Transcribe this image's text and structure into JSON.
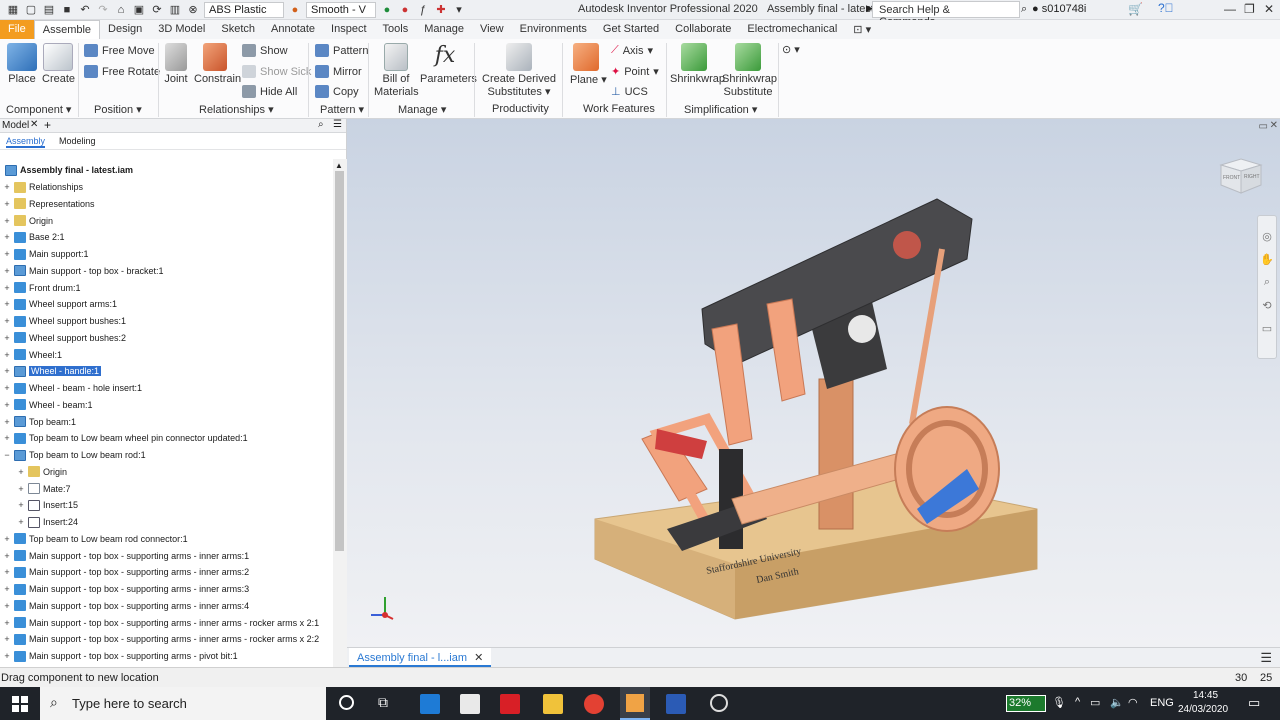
{
  "titlebar": {
    "material": "ABS Plastic",
    "visual_style": "Smooth - V",
    "window_title": "Autodesk Inventor Professional 2020",
    "document_title": "Assembly final - latest",
    "search_placeholder": "Search Help & Commands...",
    "username": "s010748i"
  },
  "menu": {
    "tabs": [
      "File",
      "Assemble",
      "Design",
      "3D Model",
      "Sketch",
      "Annotate",
      "Inspect",
      "Tools",
      "Manage",
      "View",
      "Environments",
      "Get Started",
      "Collaborate",
      "Electromechanical"
    ],
    "active": "Assemble"
  },
  "ribbon": {
    "place": "Place",
    "create": "Create",
    "free_move": "Free Move",
    "free_rotate": "Free Rotate",
    "joint": "Joint",
    "constrain": "Constrain",
    "show": "Show",
    "show_sick": "Show Sick",
    "hide_all": "Hide All",
    "pattern": "Pattern",
    "mirror": "Mirror",
    "copy": "Copy",
    "bill_line1": "Bill of",
    "bill_line2": "Materials",
    "parameters": "Parameters",
    "derived_line1": "Create Derived",
    "derived_line2": "Substitutes",
    "plane": "Plane",
    "axis": "Axis",
    "point": "Point",
    "ucs": "UCS",
    "shrinkwrap": "Shrinkwrap",
    "shrink_sub_line1": "Shrinkwrap",
    "shrink_sub_line2": "Substitute",
    "panels": {
      "component": "Component",
      "position": "Position",
      "relationships": "Relationships",
      "pattern": "Pattern",
      "manage": "Manage",
      "productivity": "Productivity",
      "work_features": "Work Features",
      "simplification": "Simplification"
    }
  },
  "browser": {
    "header": "Model",
    "tabs": [
      "Assembly",
      "Modeling"
    ],
    "root": "Assembly final - latest.iam",
    "nodes": [
      {
        "label": "Relationships",
        "type": "folder",
        "indent": 0
      },
      {
        "label": "Representations",
        "type": "folder",
        "indent": 0
      },
      {
        "label": "Origin",
        "type": "folder",
        "indent": 0
      },
      {
        "label": "Base 2:1",
        "type": "part",
        "indent": 0
      },
      {
        "label": "Main support:1",
        "type": "part",
        "indent": 0
      },
      {
        "label": "Main support - top box - bracket:1",
        "type": "asm",
        "indent": 0
      },
      {
        "label": "Front drum:1",
        "type": "part",
        "indent": 0
      },
      {
        "label": "Wheel support arms:1",
        "type": "part",
        "indent": 0
      },
      {
        "label": "Wheel support bushes:1",
        "type": "part",
        "indent": 0
      },
      {
        "label": "Wheel support bushes:2",
        "type": "part",
        "indent": 0
      },
      {
        "label": "Wheel:1",
        "type": "part",
        "indent": 0
      },
      {
        "label": "Wheel - handle:1",
        "type": "asm",
        "indent": 0,
        "selected": true
      },
      {
        "label": "Wheel - beam - hole insert:1",
        "type": "part",
        "indent": 0
      },
      {
        "label": "Wheel - beam:1",
        "type": "part",
        "indent": 0
      },
      {
        "label": "Top beam:1",
        "type": "asm",
        "indent": 0
      },
      {
        "label": "Top beam to Low beam wheel pin connector updated:1",
        "type": "part",
        "indent": 0
      },
      {
        "label": "Top beam to Low beam rod:1",
        "type": "asm",
        "indent": 0,
        "expanded": true
      },
      {
        "label": "Origin",
        "type": "folder",
        "indent": 1
      },
      {
        "label": "Mate:7",
        "type": "mate",
        "indent": 1
      },
      {
        "label": "Insert:15",
        "type": "ins",
        "indent": 1
      },
      {
        "label": "Insert:24",
        "type": "ins",
        "indent": 1
      },
      {
        "label": "Top beam to Low beam rod connector:1",
        "type": "part",
        "indent": 0
      },
      {
        "label": "Main support - top box - supporting arms  - inner arms:1",
        "type": "part",
        "indent": 0
      },
      {
        "label": "Main support - top box - supporting arms  - inner arms:2",
        "type": "part",
        "indent": 0
      },
      {
        "label": "Main support - top box - supporting arms  - inner arms:3",
        "type": "part",
        "indent": 0
      },
      {
        "label": "Main support - top box - supporting arms  - inner arms:4",
        "type": "part",
        "indent": 0
      },
      {
        "label": "Main support - top box - supporting arms  - inner arms - rocker arms x 2:1",
        "type": "part",
        "indent": 0
      },
      {
        "label": "Main support - top box - supporting arms  - inner arms - rocker arms x 2:2",
        "type": "part",
        "indent": 0
      },
      {
        "label": "Main support - top box - supporting arms  - pivot bit:1",
        "type": "part",
        "indent": 0
      }
    ]
  },
  "viewport": {
    "viewcube_front": "FRONT",
    "viewcube_right": "RIGHT",
    "engraving_line1": "Staffordshire University",
    "engraving_line2": "Dan Smith"
  },
  "doc_tab": "Assembly final - l...iam",
  "status": {
    "message": "Drag component to new location",
    "num1": "30",
    "num2": "25"
  },
  "taskbar": {
    "search_placeholder": "Type here to search",
    "battery": "32%",
    "language": "ENG",
    "time": "14:45",
    "date": "24/03/2020"
  }
}
